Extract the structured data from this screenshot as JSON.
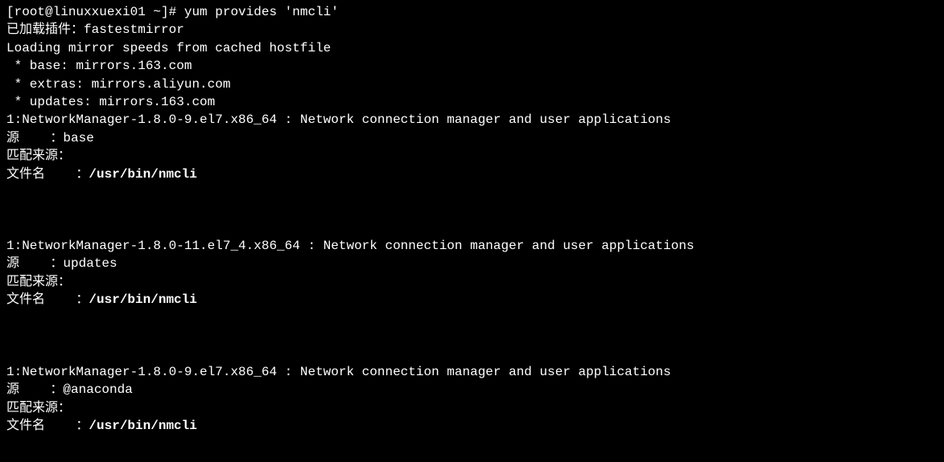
{
  "terminal": {
    "prompt": "[root@linuxxuexi01 ~]# ",
    "command": "yum provides 'nmcli'",
    "lines": {
      "plugins": "已加载插件：fastestmirror",
      "loading": "Loading mirror speeds from cached hostfile",
      "mirror_base": " * base: mirrors.163.com",
      "mirror_extras": " * extras: mirrors.aliyun.com",
      "mirror_updates": " * updates: mirrors.163.com"
    },
    "packages": [
      {
        "name_desc": "1:NetworkManager-1.8.0-9.el7.x86_64 : Network connection manager and user applications",
        "source_label": "源    ：",
        "source_value": "base",
        "match_label": "匹配来源：",
        "filename_label": "文件名    ：",
        "filename_value": "/usr/bin/nmcli"
      },
      {
        "name_desc": "1:NetworkManager-1.8.0-11.el7_4.x86_64 : Network connection manager and user applications",
        "source_label": "源    ：",
        "source_value": "updates",
        "match_label": "匹配来源：",
        "filename_label": "文件名    ：",
        "filename_value": "/usr/bin/nmcli"
      },
      {
        "name_desc": "1:NetworkManager-1.8.0-9.el7.x86_64 : Network connection manager and user applications",
        "source_label": "源    ：",
        "source_value": "@anaconda",
        "match_label": "匹配来源：",
        "filename_label": "文件名    ：",
        "filename_value": "/usr/bin/nmcli"
      }
    ]
  }
}
